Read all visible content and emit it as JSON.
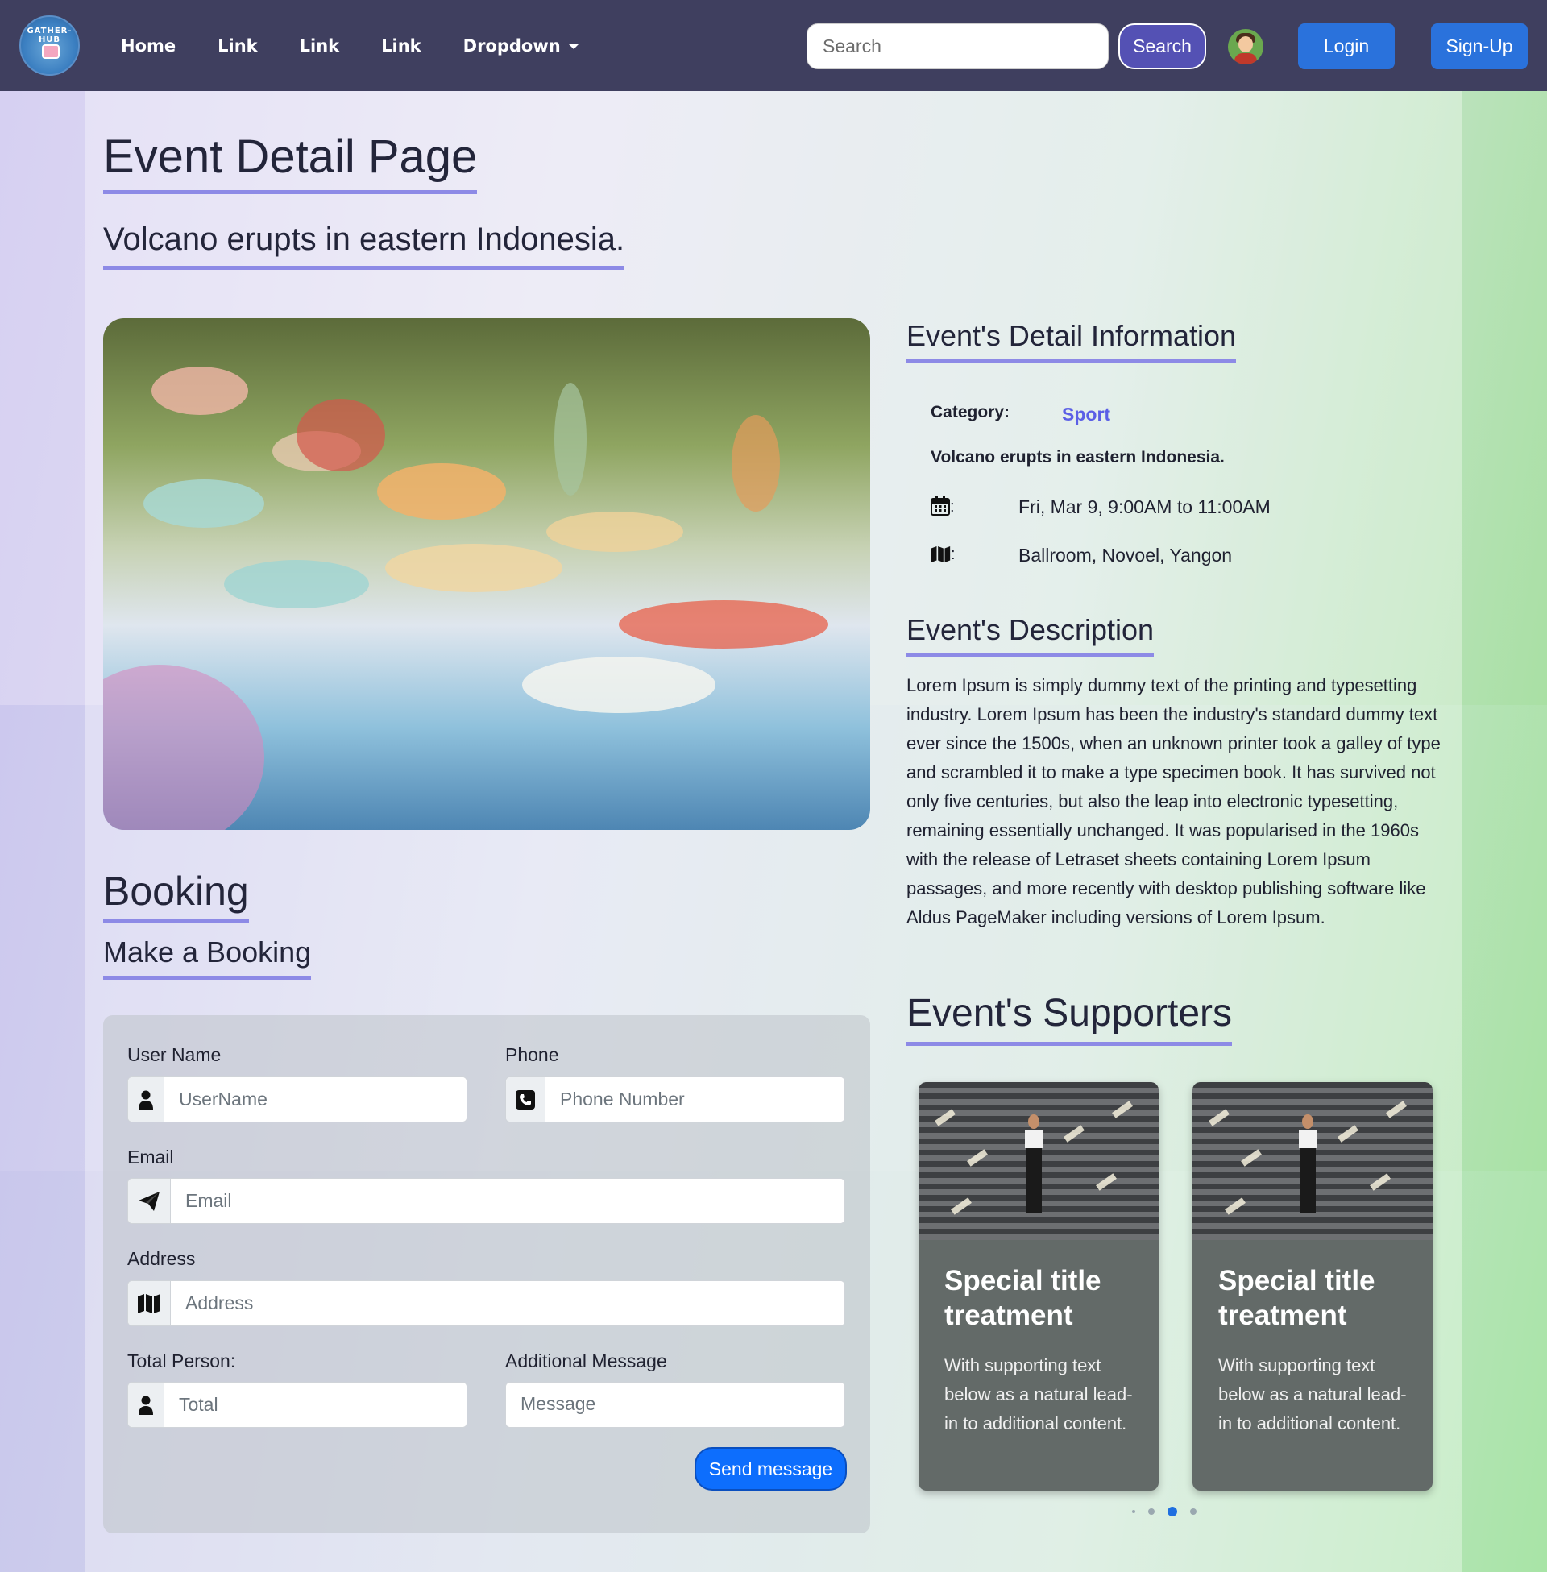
{
  "nav": {
    "links": [
      "Home",
      "Link",
      "Link",
      "Link"
    ],
    "dropdown_label": "Dropdown",
    "search_placeholder": "Search",
    "search_button": "Search",
    "login": "Login",
    "signup": "Sign-Up",
    "logo_text": "GATHER-HUB"
  },
  "page": {
    "title": "Event Detail Page",
    "subtitle": "Volcano erupts in eastern Indonesia."
  },
  "booking": {
    "title": "Booking",
    "subtitle": "Make a Booking",
    "fields": {
      "username_label": "User Name",
      "username_placeholder": "UserName",
      "phone_label": "Phone",
      "phone_placeholder": "Phone Number",
      "email_label": "Email",
      "email_placeholder": "Email",
      "address_label": "Address",
      "address_placeholder": "Address",
      "total_label": "Total Person:",
      "total_placeholder": "Total",
      "message_label": "Additional Message",
      "message_placeholder": "Message"
    },
    "submit": "Send message"
  },
  "detail": {
    "title": "Event's Detail Information",
    "category_label": "Category:",
    "category_value": "Sport",
    "event_name": "Volcano erupts in eastern Indonesia.",
    "date_colon": ":",
    "date": "Fri, Mar 9, 9:00AM to 11:00AM",
    "place_colon": ":",
    "place": "Ballroom, Novoel, Yangon"
  },
  "description": {
    "title": "Event's Description",
    "text": "Lorem Ipsum is simply dummy text of the printing and typesetting industry. Lorem Ipsum has been the industry's standard dummy text ever since the 1500s, when an unknown printer took a galley of type and scrambled it to make a type specimen book. It has survived not only five centuries, but also the leap into electronic typesetting, remaining essentially unchanged. It was popularised in the 1960s with the release of Letraset sheets containing Lorem Ipsum passages, and more recently with desktop publishing software like Aldus PageMaker including versions of Lorem Ipsum."
  },
  "supporters": {
    "title": "Event's Supporters",
    "cards": [
      {
        "title": "Special title treatment",
        "text": "With supporting text below as a natural lead-in to additional content."
      },
      {
        "title": "Special title treatment",
        "text": "With supporting text below as a natural lead-in to additional content."
      }
    ],
    "active_slide": 3,
    "slide_count": 4
  },
  "colors": {
    "navbar": "#3f3f5f",
    "accent_underline": "#8d8ae6",
    "primary_button": "#0d6efd",
    "category": "#5b5fe6"
  },
  "icons": {
    "user": "user-icon",
    "phone": "phone-icon",
    "email": "paper-plane-icon",
    "address": "map-icon",
    "date": "calendar-icon",
    "place": "map-icon"
  }
}
